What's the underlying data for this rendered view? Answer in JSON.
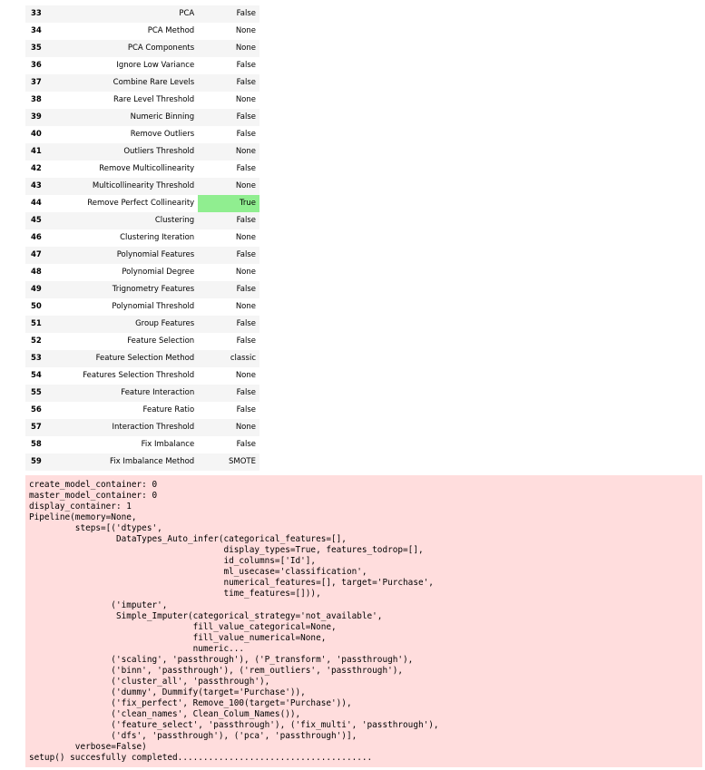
{
  "table": {
    "rows": [
      {
        "index": "33",
        "description": "PCA",
        "value": "False",
        "highlight": false
      },
      {
        "index": "34",
        "description": "PCA Method",
        "value": "None",
        "highlight": false
      },
      {
        "index": "35",
        "description": "PCA Components",
        "value": "None",
        "highlight": false
      },
      {
        "index": "36",
        "description": "Ignore Low Variance",
        "value": "False",
        "highlight": false
      },
      {
        "index": "37",
        "description": "Combine Rare Levels",
        "value": "False",
        "highlight": false
      },
      {
        "index": "38",
        "description": "Rare Level Threshold",
        "value": "None",
        "highlight": false
      },
      {
        "index": "39",
        "description": "Numeric Binning",
        "value": "False",
        "highlight": false
      },
      {
        "index": "40",
        "description": "Remove Outliers",
        "value": "False",
        "highlight": false
      },
      {
        "index": "41",
        "description": "Outliers Threshold",
        "value": "None",
        "highlight": false
      },
      {
        "index": "42",
        "description": "Remove Multicollinearity",
        "value": "False",
        "highlight": false
      },
      {
        "index": "43",
        "description": "Multicollinearity Threshold",
        "value": "None",
        "highlight": false
      },
      {
        "index": "44",
        "description": "Remove Perfect Collinearity",
        "value": "True",
        "highlight": true
      },
      {
        "index": "45",
        "description": "Clustering",
        "value": "False",
        "highlight": false
      },
      {
        "index": "46",
        "description": "Clustering Iteration",
        "value": "None",
        "highlight": false
      },
      {
        "index": "47",
        "description": "Polynomial Features",
        "value": "False",
        "highlight": false
      },
      {
        "index": "48",
        "description": "Polynomial Degree",
        "value": "None",
        "highlight": false
      },
      {
        "index": "49",
        "description": "Trignometry Features",
        "value": "False",
        "highlight": false
      },
      {
        "index": "50",
        "description": "Polynomial Threshold",
        "value": "None",
        "highlight": false
      },
      {
        "index": "51",
        "description": "Group Features",
        "value": "False",
        "highlight": false
      },
      {
        "index": "52",
        "description": "Feature Selection",
        "value": "False",
        "highlight": false
      },
      {
        "index": "53",
        "description": "Feature Selection Method",
        "value": "classic",
        "highlight": false
      },
      {
        "index": "54",
        "description": "Features Selection Threshold",
        "value": "None",
        "highlight": false
      },
      {
        "index": "55",
        "description": "Feature Interaction",
        "value": "False",
        "highlight": false
      },
      {
        "index": "56",
        "description": "Feature Ratio",
        "value": "False",
        "highlight": false
      },
      {
        "index": "57",
        "description": "Interaction Threshold",
        "value": "None",
        "highlight": false
      },
      {
        "index": "58",
        "description": "Fix Imbalance",
        "value": "False",
        "highlight": false
      },
      {
        "index": "59",
        "description": "Fix Imbalance Method",
        "value": "SMOTE",
        "highlight": false
      }
    ]
  },
  "output": {
    "lines": [
      "create_model_container: 0",
      "master_model_container: 0",
      "display_container: 1",
      "Pipeline(memory=None,",
      "         steps=[('dtypes',",
      "                 DataTypes_Auto_infer(categorical_features=[],",
      "                                      display_types=True, features_todrop=[],",
      "                                      id_columns=['Id'],",
      "                                      ml_usecase='classification',",
      "                                      numerical_features=[], target='Purchase',",
      "                                      time_features=[])),",
      "                ('imputer',",
      "                 Simple_Imputer(categorical_strategy='not_available',",
      "                                fill_value_categorical=None,",
      "                                fill_value_numerical=None,",
      "                                numeric...",
      "                ('scaling', 'passthrough'), ('P_transform', 'passthrough'),",
      "                ('binn', 'passthrough'), ('rem_outliers', 'passthrough'),",
      "                ('cluster_all', 'passthrough'),",
      "                ('dummy', Dummify(target='Purchase')),",
      "                ('fix_perfect', Remove_100(target='Purchase')),",
      "                ('clean_names', Clean_Colum_Names()),",
      "                ('feature_select', 'passthrough'), ('fix_multi', 'passthrough'),",
      "                ('dfs', 'passthrough'), ('pca', 'passthrough')],",
      "         verbose=False)",
      "setup() succesfully completed......................................"
    ]
  },
  "colors": {
    "highlight": "#90ee90",
    "output_background": "#ffdddd",
    "row_stripe": "#f5f5f5"
  }
}
